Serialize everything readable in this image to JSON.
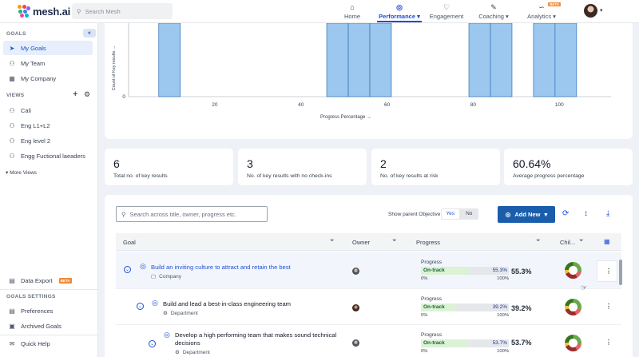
{
  "brand": {
    "name": "mesh.ai"
  },
  "search": {
    "placeholder": "Search Mesh"
  },
  "nav": {
    "home": "Home",
    "performance": "Performance",
    "engagement": "Engagement",
    "coaching": "Coaching",
    "analytics": "Analytics",
    "analytics_badge": "BETA"
  },
  "sidebar": {
    "goals_header": "GOALS",
    "goals": [
      "My Goals",
      "My Team",
      "My Company"
    ],
    "views_header": "VIEWS",
    "views": [
      "Cali",
      "Eng L1+L2",
      "Eng level 2",
      "Engg Fuctional laeaders"
    ],
    "more_views": "More Views",
    "data_export": "Data Export",
    "data_export_badge": "BETA",
    "settings_header": "GOALS SETTINGS",
    "settings": [
      "Preferences",
      "Archived Goals"
    ],
    "quick_help": "Quick Help"
  },
  "chart_data": {
    "type": "bar",
    "xlabel": "Progress Percentage →",
    "ylabel": "Count of Key results →",
    "xticks": [
      20,
      40,
      60,
      80,
      100
    ],
    "yticks": [
      0
    ],
    "xlim": [
      0,
      112
    ],
    "bars": [
      {
        "x0": 7,
        "x1": 12
      },
      {
        "x0": 46,
        "x1": 51
      },
      {
        "x0": 51,
        "x1": 56
      },
      {
        "x0": 56,
        "x1": 61
      },
      {
        "x0": 79,
        "x1": 84
      },
      {
        "x0": 84,
        "x1": 89
      },
      {
        "x0": 94,
        "x1": 99
      },
      {
        "x0": 99,
        "x1": 104
      }
    ]
  },
  "stats": [
    {
      "value": "6",
      "label": "Total no. of key results"
    },
    {
      "value": "3",
      "label": "No. of key results with no check-ins"
    },
    {
      "value": "2",
      "label": "No. of key results at risk"
    },
    {
      "value": "60.64%",
      "label": "Average progress percentage"
    }
  ],
  "table": {
    "search_placeholder": "Search across title, owner, progress etc.",
    "show_parent_label": "Show parent Objective",
    "toggle_yes": "Yes",
    "toggle_no": "No",
    "add_new": "Add New",
    "headers": {
      "goal": "Goal",
      "owner": "Owner",
      "progress": "Progress",
      "children": "Chil..."
    },
    "rows": [
      {
        "title": "Build an inviting culture to attract and retain the best",
        "scope": "Company",
        "progress_label": "Progress",
        "status": "On-track",
        "percent": "55.3%",
        "percent_value": 55.3,
        "min": "0%",
        "max": "100%"
      },
      {
        "title": "Build and lead a best-in-class engineering team",
        "scope": "Department",
        "progress_label": "Progress",
        "status": "On-track",
        "percent": "39.2%",
        "percent_value": 39.2,
        "min": "0%",
        "max": "100%"
      },
      {
        "title": "Develop a high performing team that makes sound technical decisions",
        "scope": "Department",
        "progress_label": "Progress",
        "status": "On-track",
        "percent": "53.7%",
        "percent_value": 53.7,
        "min": "0%",
        "max": "100%"
      }
    ]
  }
}
